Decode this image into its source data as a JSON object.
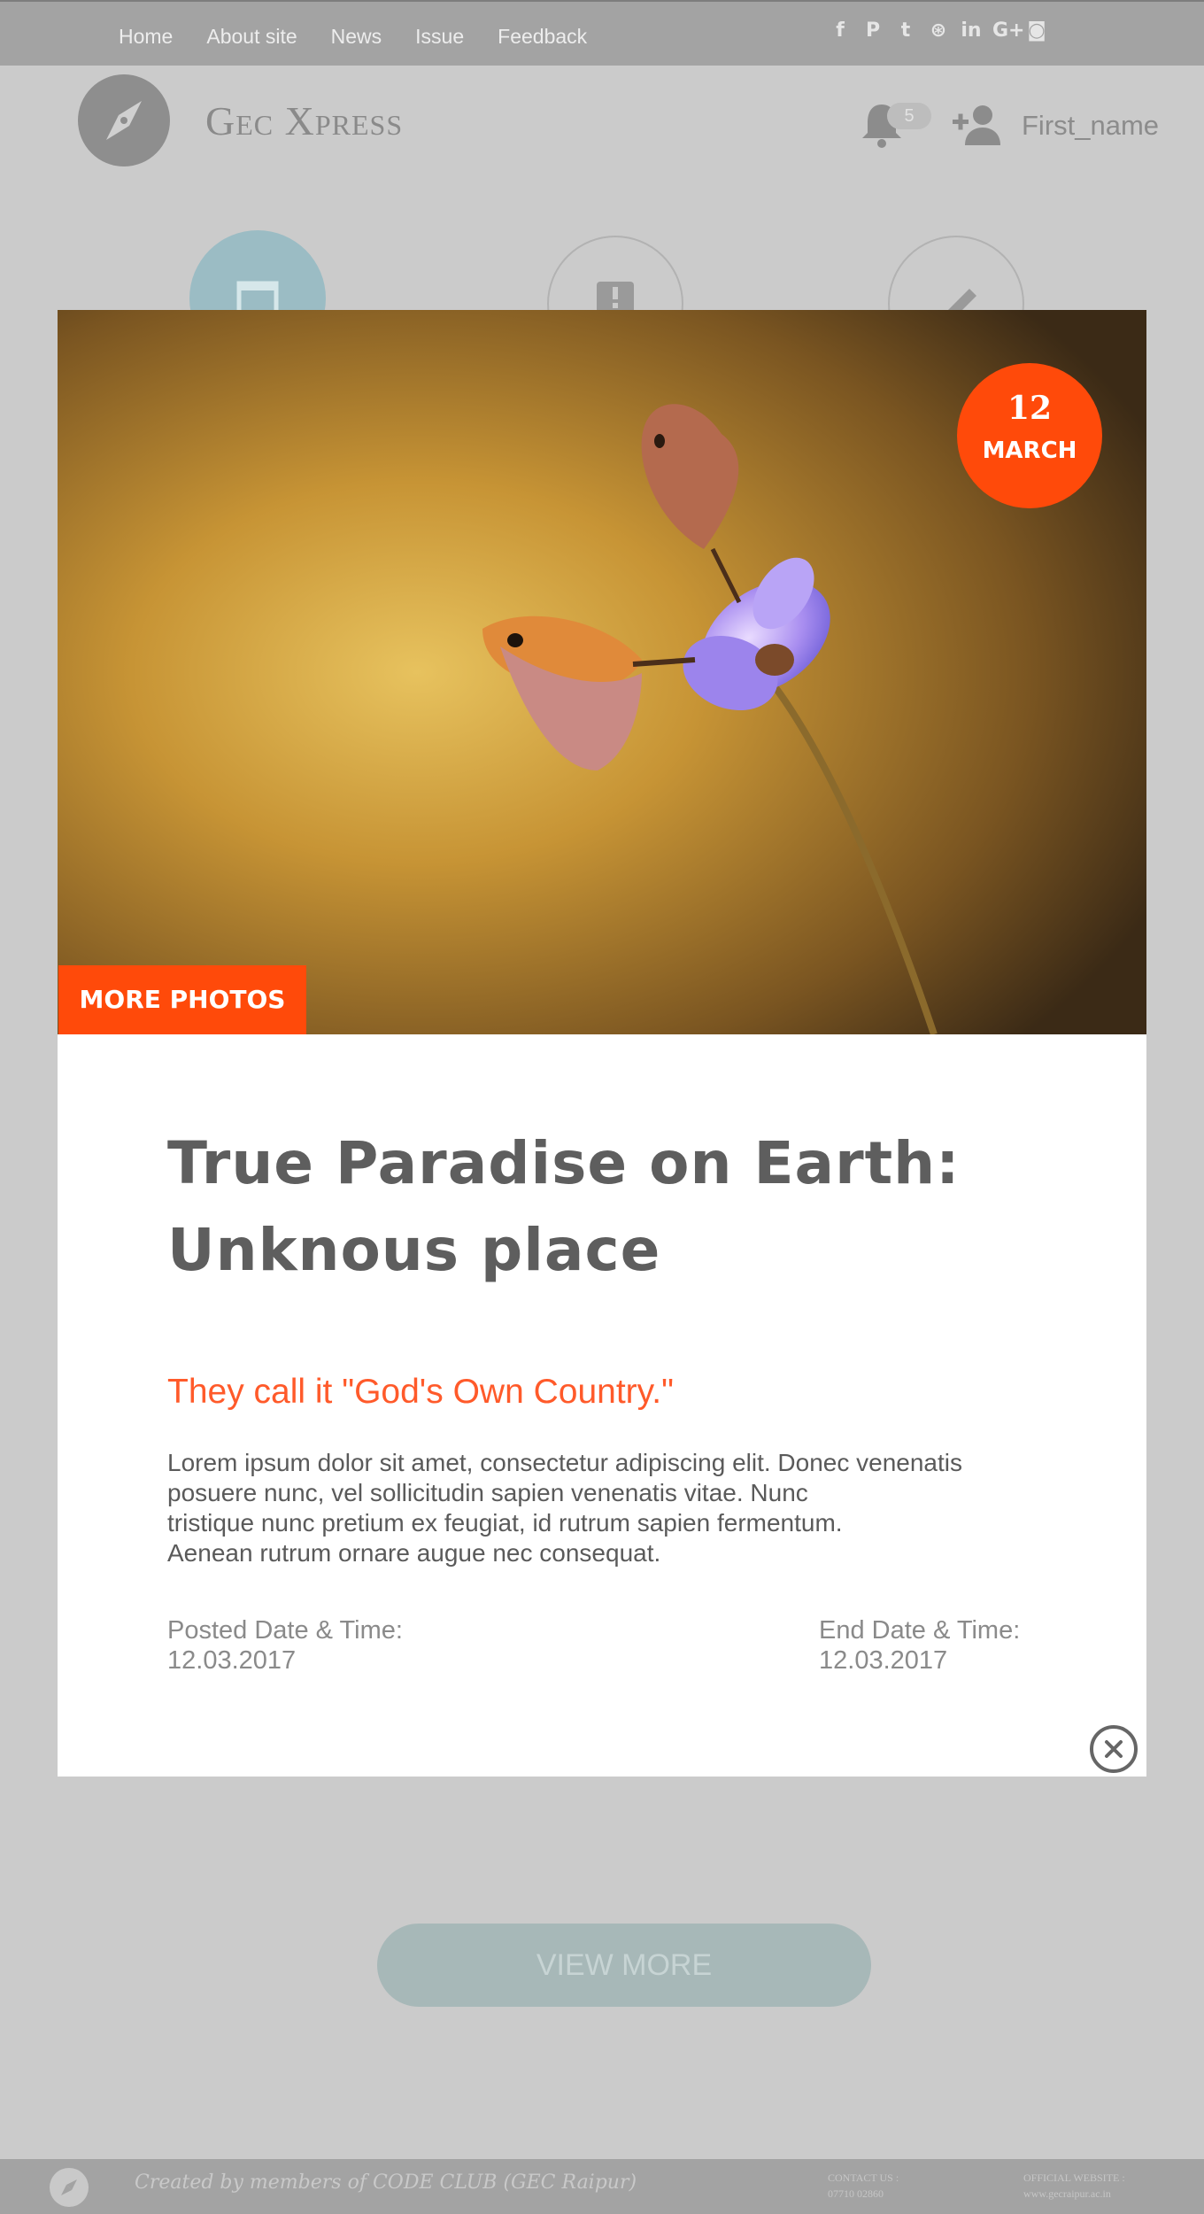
{
  "nav": {
    "links": [
      "Home",
      "About site",
      "News",
      "Issue",
      "Feedback"
    ],
    "social_icons": [
      "facebook-icon",
      "pinterest-icon",
      "twitter-icon",
      "dribbble-icon",
      "linkedin-icon",
      "google-plus-icon",
      "rss-icon"
    ],
    "social_glyphs": [
      "f",
      "P",
      "t",
      "⊛",
      "in",
      "G+",
      "◙"
    ]
  },
  "header": {
    "site_title": "Gec Xpress",
    "notification_count": "5",
    "username": "First_name"
  },
  "modal": {
    "date_day": "12",
    "date_month": "MARCH",
    "more_photos_label": "MORE PHOTOS",
    "title": "True Paradise on Earth: Unknous place",
    "subtitle": "They call it \"God's Own Country.\"",
    "body_lines": [
      "Lorem ipsum dolor sit amet, consectetur adipiscing elit. Donec venenatis",
      "posuere nunc, vel sollicitudin sapien venenatis vitae. Nunc",
      "tristique nunc pretium ex feugiat, id rutrum sapien fermentum.",
      "Aenean rutrum ornare augue nec consequat."
    ],
    "posted_label": "Posted Date & Time:",
    "posted_value": "12.03.2017",
    "end_label": "End Date & Time:",
    "end_value": "12.03.2017"
  },
  "view_more_label": "VIEW MORE",
  "footer": {
    "credit": "Created by members of CODE CLUB (GEC Raipur)",
    "contact_label": "CONTACT US :",
    "contact_value": "07710 02860",
    "website_label": "OFFICIAL WEBSITE :",
    "website_value": "www.gecraipur.ac.in"
  },
  "colors": {
    "accent": "#ff4a0a",
    "subtitle": "#ff5a2a",
    "overlay_bg": "#cbcbcb",
    "topbar": "#a3a3a3",
    "view_more": "#a7b8b8"
  }
}
